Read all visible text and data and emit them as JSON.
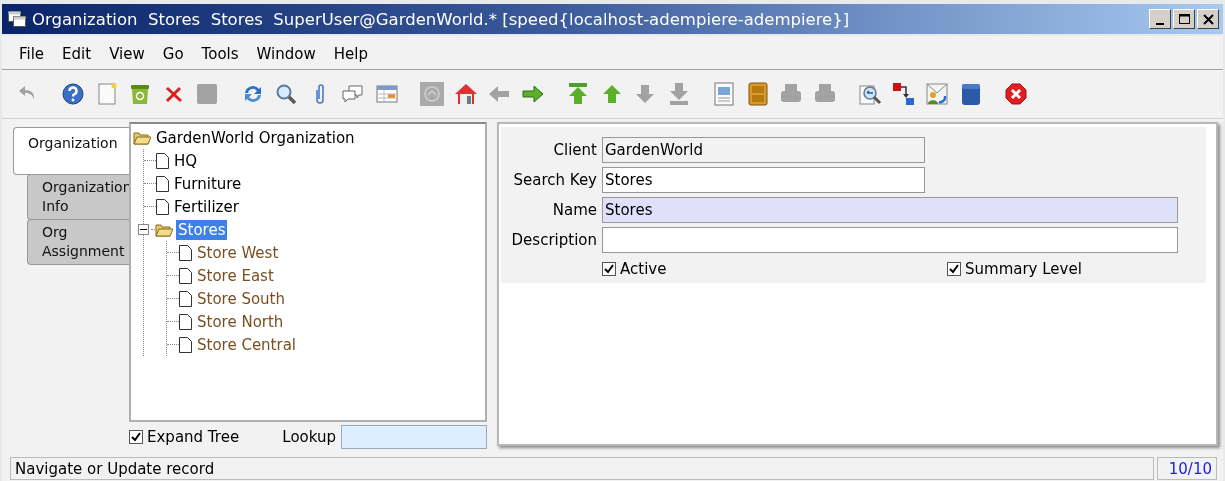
{
  "window": {
    "title": "Organization  Stores  Stores  SuperUser@GardenWorld.* [speed{localhost-adempiere-adempiere}]"
  },
  "menu": [
    "File",
    "Edit",
    "View",
    "Go",
    "Tools",
    "Window",
    "Help"
  ],
  "toolbar": {
    "groups": [
      [
        {
          "kind": "undo",
          "disabled": true
        }
      ],
      [
        {
          "kind": "help",
          "disabled": false
        },
        {
          "kind": "new",
          "disabled": false
        },
        {
          "kind": "copy",
          "disabled": false
        },
        {
          "kind": "delete",
          "disabled": false
        },
        {
          "kind": "save",
          "disabled": true
        }
      ],
      [
        {
          "kind": "refresh",
          "disabled": false
        },
        {
          "kind": "find",
          "disabled": false
        },
        {
          "kind": "attach",
          "disabled": false
        },
        {
          "kind": "chat",
          "disabled": false
        },
        {
          "kind": "grid",
          "disabled": false
        }
      ],
      [
        {
          "kind": "history",
          "disabled": false
        },
        {
          "kind": "home",
          "disabled": false
        },
        {
          "kind": "back",
          "disabled": true
        },
        {
          "kind": "forward",
          "disabled": false
        }
      ],
      [
        {
          "kind": "first",
          "disabled": false
        },
        {
          "kind": "up",
          "disabled": false
        },
        {
          "kind": "down",
          "disabled": true
        },
        {
          "kind": "last",
          "disabled": true
        }
      ],
      [
        {
          "kind": "report",
          "disabled": false
        },
        {
          "kind": "archive",
          "disabled": false
        },
        {
          "kind": "preview",
          "disabled": true
        },
        {
          "kind": "print",
          "disabled": true
        }
      ],
      [
        {
          "kind": "zoom",
          "disabled": false
        },
        {
          "kind": "workflow",
          "disabled": false
        },
        {
          "kind": "requests",
          "disabled": false
        },
        {
          "kind": "product",
          "disabled": false
        }
      ],
      [
        {
          "kind": "exit",
          "disabled": false
        }
      ]
    ]
  },
  "tabs": [
    {
      "label": "Organization",
      "selected": true
    },
    {
      "label": "Organization Info",
      "selected": false
    },
    {
      "label": "Org Assignment",
      "selected": false
    }
  ],
  "tree": {
    "root": {
      "label": "GardenWorld Organization",
      "kind": "folder",
      "expanded": true,
      "selected": false,
      "color": "#000000",
      "children": [
        {
          "label": "HQ",
          "kind": "leaf",
          "selected": false,
          "color": "#000000"
        },
        {
          "label": "Furniture",
          "kind": "leaf",
          "selected": false,
          "color": "#000000"
        },
        {
          "label": "Fertilizer",
          "kind": "leaf",
          "selected": false,
          "color": "#000000"
        },
        {
          "label": "Stores",
          "kind": "folder",
          "expanded": true,
          "selected": true,
          "children": [
            {
              "label": "Store West",
              "kind": "leaf",
              "selected": false,
              "color": "#7b4f22"
            },
            {
              "label": "Store East",
              "kind": "leaf",
              "selected": false,
              "color": "#7b4f22"
            },
            {
              "label": "Store South",
              "kind": "leaf",
              "selected": false,
              "color": "#7b4f22"
            },
            {
              "label": "Store North",
              "kind": "leaf",
              "selected": false,
              "color": "#7b4f22"
            },
            {
              "label": "Store Central",
              "kind": "leaf",
              "selected": false,
              "color": "#7b4f22"
            }
          ]
        }
      ]
    }
  },
  "expand_tree": {
    "label": "Expand Tree",
    "checked": true
  },
  "lookup": {
    "label": "Lookup"
  },
  "form": {
    "fields": [
      {
        "label": "Client",
        "value": "GardenWorld",
        "readonly": true,
        "mandatory": false
      },
      {
        "label": "Search Key",
        "value": "Stores",
        "readonly": false,
        "mandatory": false
      },
      {
        "label": "Name",
        "value": "Stores",
        "readonly": false,
        "mandatory": true
      },
      {
        "label": "Description",
        "readonly": false,
        "mandatory": false
      }
    ],
    "checkboxes": [
      {
        "label": "Active",
        "checked": true
      },
      {
        "label": "Summary Level",
        "checked": true
      }
    ]
  },
  "status_bar": {
    "message": "Navigate or Update record",
    "record": "10/10"
  }
}
